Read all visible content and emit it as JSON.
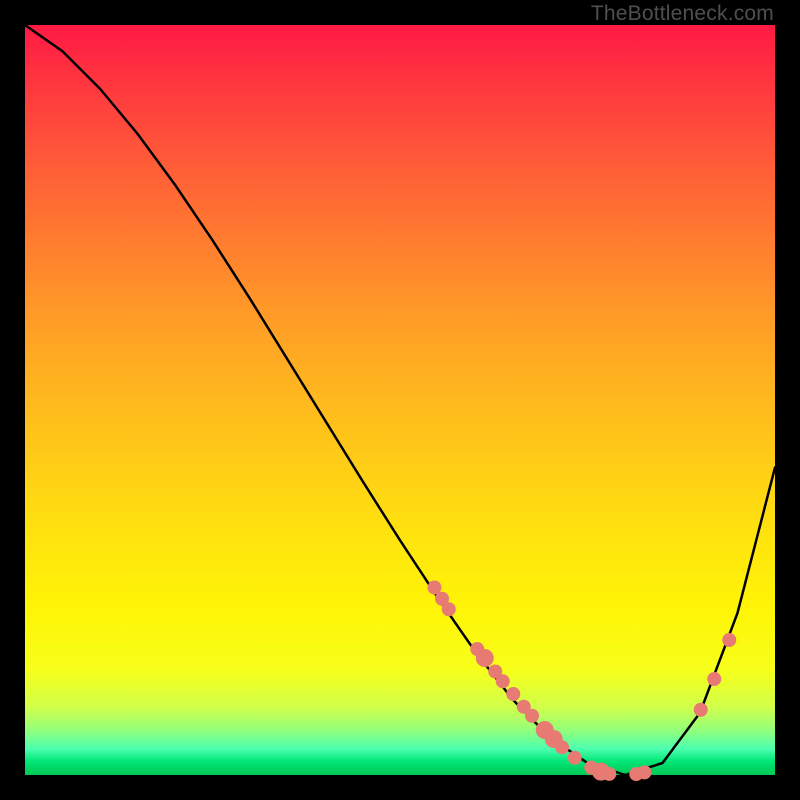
{
  "watermark_text": "TheBottleneck.com",
  "colors": {
    "page_bg": "#000000",
    "curve": "#000000",
    "dot_fill": "#e77b73",
    "watermark": "#4f4f4f"
  },
  "chart_data": {
    "type": "line",
    "title": "",
    "xlabel": "",
    "ylabel": "",
    "x": [
      0.0,
      0.05,
      0.1,
      0.15,
      0.2,
      0.25,
      0.3,
      0.35,
      0.4,
      0.45,
      0.5,
      0.55,
      0.6,
      0.65,
      0.7,
      0.75,
      0.8,
      0.85,
      0.9,
      0.95,
      1.0
    ],
    "values": [
      100,
      96.5,
      91.5,
      85.5,
      78.7,
      71.3,
      63.5,
      55.4,
      47.3,
      39.2,
      31.3,
      23.7,
      16.5,
      10.1,
      5.0,
      1.6,
      0.0,
      1.6,
      8.3,
      21.6,
      41.0
    ],
    "xlim": [
      0,
      1
    ],
    "ylim": [
      0,
      100
    ],
    "dots": [
      {
        "x": 0.546,
        "y": 25.0
      },
      {
        "x": 0.556,
        "y": 23.5
      },
      {
        "x": 0.565,
        "y": 22.1
      },
      {
        "x": 0.603,
        "y": 16.8
      },
      {
        "x": 0.613,
        "y": 15.6,
        "r": 9
      },
      {
        "x": 0.627,
        "y": 13.8
      },
      {
        "x": 0.637,
        "y": 12.5
      },
      {
        "x": 0.651,
        "y": 10.8
      },
      {
        "x": 0.665,
        "y": 9.1
      },
      {
        "x": 0.676,
        "y": 7.9
      },
      {
        "x": 0.693,
        "y": 6.0,
        "r": 9
      },
      {
        "x": 0.705,
        "y": 4.8,
        "r": 9
      },
      {
        "x": 0.716,
        "y": 3.7
      },
      {
        "x": 0.733,
        "y": 2.3
      },
      {
        "x": 0.755,
        "y": 1.0
      },
      {
        "x": 0.768,
        "y": 0.45,
        "r": 9
      },
      {
        "x": 0.779,
        "y": 0.15
      },
      {
        "x": 0.815,
        "y": 0.13
      },
      {
        "x": 0.826,
        "y": 0.35
      },
      {
        "x": 0.901,
        "y": 8.7
      },
      {
        "x": 0.919,
        "y": 12.8
      },
      {
        "x": 0.939,
        "y": 18.0
      }
    ]
  }
}
